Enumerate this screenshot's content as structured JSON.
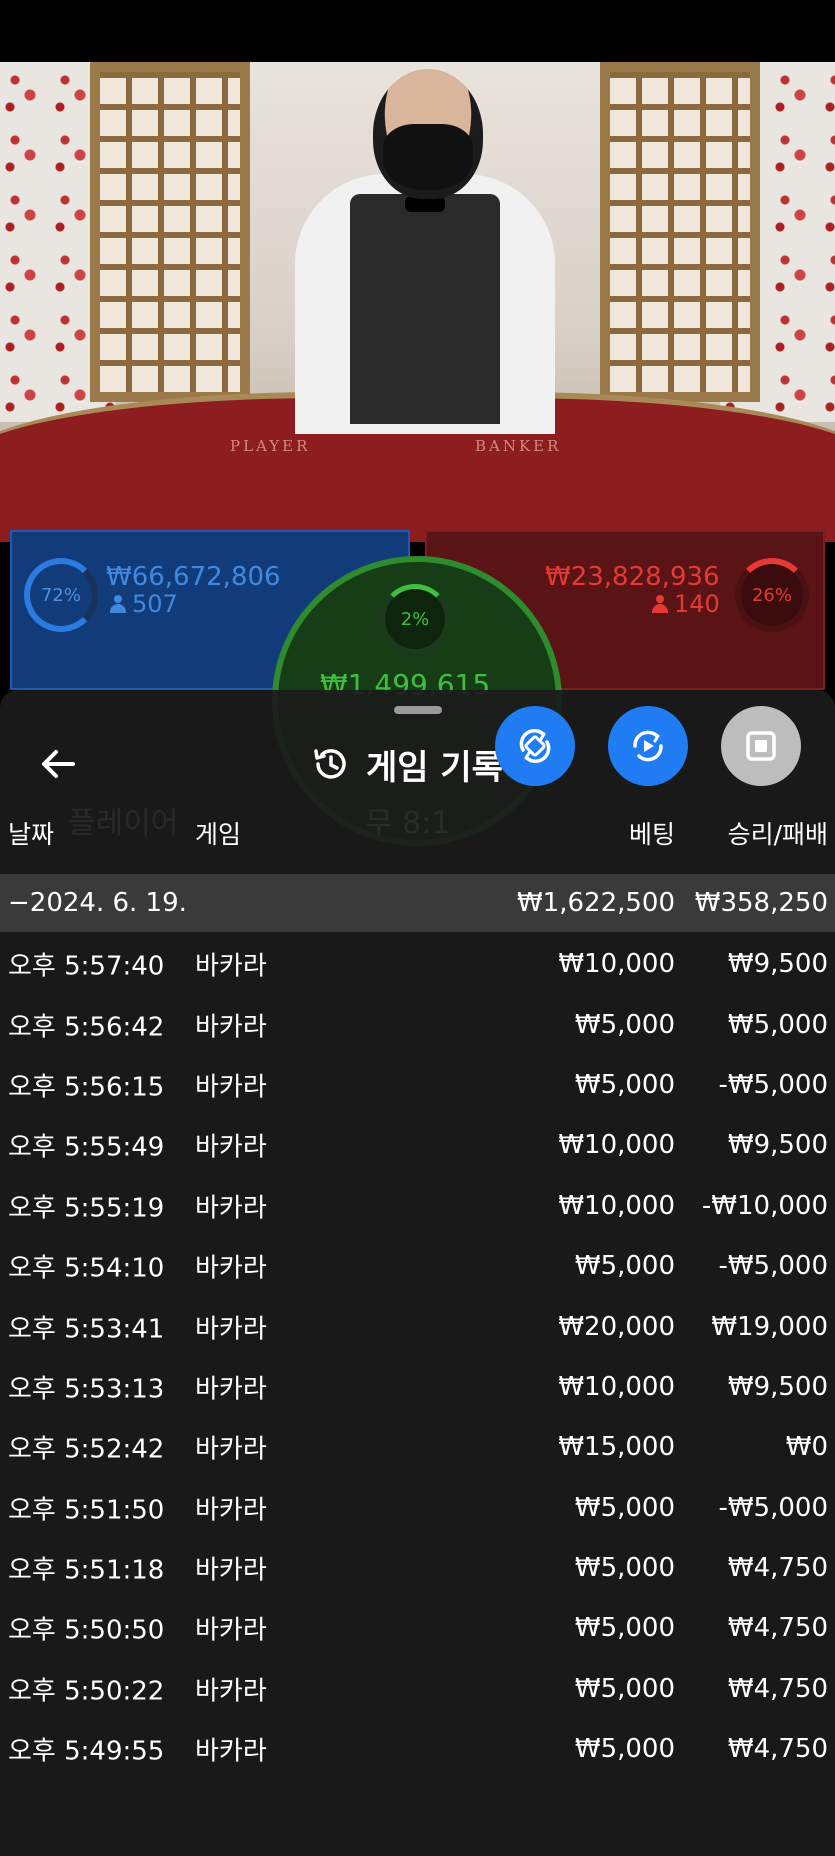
{
  "scene": {
    "table_player": "PLAYER",
    "table_banker": "BANKER"
  },
  "bets": {
    "player": {
      "percent": "72%",
      "amount": "₩66,672,806",
      "count": "507"
    },
    "banker": {
      "percent": "26%",
      "amount": "₩23,828,936",
      "count": "140"
    },
    "tie": {
      "percent": "2%",
      "amount": "₩1,499,615"
    }
  },
  "background_hints": {
    "player_label": "플레이어",
    "tie_label": "무 8:1"
  },
  "sheet": {
    "title": "게임 기록",
    "back_icon": "arrow-left-icon",
    "history_icon": "history-icon",
    "columns": {
      "date": "날짜",
      "game": "게임",
      "bet": "베팅",
      "result": "승리/패배"
    },
    "summary": {
      "date": "−2024. 6. 19.",
      "bet": "₩1,622,500",
      "result": "₩358,250"
    },
    "rows": [
      {
        "time": "오후 5:57:40",
        "game": "바카라",
        "bet": "₩10,000",
        "result": "₩9,500"
      },
      {
        "time": "오후 5:56:42",
        "game": "바카라",
        "bet": "₩5,000",
        "result": "₩5,000"
      },
      {
        "time": "오후 5:56:15",
        "game": "바카라",
        "bet": "₩5,000",
        "result": "-₩5,000"
      },
      {
        "time": "오후 5:55:49",
        "game": "바카라",
        "bet": "₩10,000",
        "result": "₩9,500"
      },
      {
        "time": "오후 5:55:19",
        "game": "바카라",
        "bet": "₩10,000",
        "result": "-₩10,000"
      },
      {
        "time": "오후 5:54:10",
        "game": "바카라",
        "bet": "₩5,000",
        "result": "-₩5,000"
      },
      {
        "time": "오후 5:53:41",
        "game": "바카라",
        "bet": "₩20,000",
        "result": "₩19,000"
      },
      {
        "time": "오후 5:53:13",
        "game": "바카라",
        "bet": "₩10,000",
        "result": "₩9,500"
      },
      {
        "time": "오후 5:52:42",
        "game": "바카라",
        "bet": "₩15,000",
        "result": "₩0"
      },
      {
        "time": "오후 5:51:50",
        "game": "바카라",
        "bet": "₩5,000",
        "result": "-₩5,000"
      },
      {
        "time": "오후 5:51:18",
        "game": "바카라",
        "bet": "₩5,000",
        "result": "₩4,750"
      },
      {
        "time": "오후 5:50:50",
        "game": "바카라",
        "bet": "₩5,000",
        "result": "₩4,750"
      },
      {
        "time": "오후 5:50:22",
        "game": "바카라",
        "bet": "₩5,000",
        "result": "₩4,750"
      },
      {
        "time": "오후 5:49:55",
        "game": "바카라",
        "bet": "₩5,000",
        "result": "₩4,750"
      }
    ]
  },
  "colors": {
    "player_blue": "#3f8ae0",
    "banker_red": "#e53935",
    "tie_green": "#3fbf3f",
    "fab_blue": "#1f7cf2",
    "fab_grey": "#bdbdbd"
  },
  "fab_icons": [
    "sync-icon",
    "replay-icon",
    "stop-icon"
  ]
}
